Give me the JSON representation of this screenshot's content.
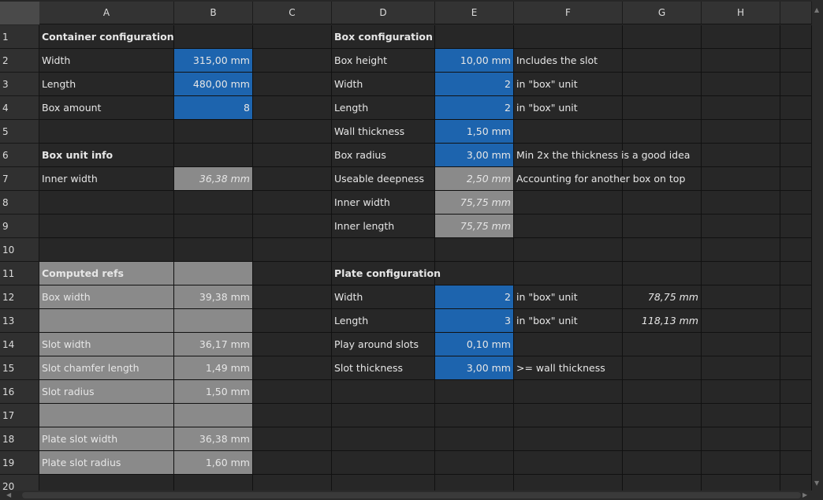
{
  "columns": [
    "A",
    "B",
    "C",
    "D",
    "E",
    "F",
    "G",
    "H"
  ],
  "rows": [
    "1",
    "2",
    "3",
    "4",
    "5",
    "6",
    "7",
    "8",
    "9",
    "10",
    "11",
    "12",
    "13",
    "14",
    "15",
    "16",
    "17",
    "18",
    "19",
    "20"
  ],
  "cells": [
    {
      "ref": "A1",
      "v": "Container configuration",
      "bold": true
    },
    {
      "ref": "D1",
      "v": "Box configuration",
      "bold": true
    },
    {
      "ref": "A2",
      "v": "Width"
    },
    {
      "ref": "B2",
      "v": "315,00 mm",
      "align": "right",
      "fill": "blue"
    },
    {
      "ref": "D2",
      "v": "Box height"
    },
    {
      "ref": "E2",
      "v": "10,00 mm",
      "align": "right",
      "fill": "blue"
    },
    {
      "ref": "F2",
      "v": "Includes the slot"
    },
    {
      "ref": "A3",
      "v": "Length"
    },
    {
      "ref": "B3",
      "v": "480,00 mm",
      "align": "right",
      "fill": "blue"
    },
    {
      "ref": "D3",
      "v": "Width"
    },
    {
      "ref": "E3",
      "v": "2",
      "align": "right",
      "fill": "blue"
    },
    {
      "ref": "F3",
      "v": "in \"box\" unit"
    },
    {
      "ref": "A4",
      "v": "Box amount"
    },
    {
      "ref": "B4",
      "v": "8",
      "align": "right",
      "fill": "blue"
    },
    {
      "ref": "D4",
      "v": "Length"
    },
    {
      "ref": "E4",
      "v": "2",
      "align": "right",
      "fill": "blue"
    },
    {
      "ref": "F4",
      "v": "in \"box\" unit"
    },
    {
      "ref": "D5",
      "v": "Wall thickness"
    },
    {
      "ref": "E5",
      "v": "1,50 mm",
      "align": "right",
      "fill": "blue"
    },
    {
      "ref": "A6",
      "v": "Box unit info",
      "bold": true
    },
    {
      "ref": "D6",
      "v": "Box radius"
    },
    {
      "ref": "E6",
      "v": "3,00 mm",
      "align": "right",
      "fill": "blue"
    },
    {
      "ref": "F6",
      "v": "Min 2x the thickness is a good idea"
    },
    {
      "ref": "A7",
      "v": "Inner width"
    },
    {
      "ref": "B7",
      "v": "36,38 mm",
      "align": "right",
      "fill": "gray",
      "italic": true
    },
    {
      "ref": "D7",
      "v": "Useable deepness"
    },
    {
      "ref": "E7",
      "v": "2,50 mm",
      "align": "right",
      "fill": "gray",
      "italic": true
    },
    {
      "ref": "F7",
      "v": "Accounting for another box on top"
    },
    {
      "ref": "D8",
      "v": "Inner width"
    },
    {
      "ref": "E8",
      "v": "75,75 mm",
      "align": "right",
      "fill": "gray",
      "italic": true
    },
    {
      "ref": "D9",
      "v": "Inner length"
    },
    {
      "ref": "E9",
      "v": "75,75 mm",
      "align": "right",
      "fill": "gray",
      "italic": true
    },
    {
      "ref": "A11",
      "v": "Computed refs",
      "bold": true,
      "fill": "gray"
    },
    {
      "ref": "B11",
      "v": "",
      "fill": "gray"
    },
    {
      "ref": "D11",
      "v": "Plate configuration",
      "bold": true
    },
    {
      "ref": "A12",
      "v": "Box width",
      "fill": "gray"
    },
    {
      "ref": "B12",
      "v": "39,38 mm",
      "align": "right",
      "fill": "gray"
    },
    {
      "ref": "D12",
      "v": "Width"
    },
    {
      "ref": "E12",
      "v": "2",
      "align": "right",
      "fill": "blue"
    },
    {
      "ref": "F12",
      "v": "in \"box\" unit"
    },
    {
      "ref": "G12",
      "v": "78,75 mm",
      "align": "right",
      "italic": true
    },
    {
      "ref": "A13",
      "v": "",
      "fill": "gray"
    },
    {
      "ref": "B13",
      "v": "",
      "fill": "gray"
    },
    {
      "ref": "D13",
      "v": "Length"
    },
    {
      "ref": "E13",
      "v": "3",
      "align": "right",
      "fill": "blue"
    },
    {
      "ref": "F13",
      "v": "in \"box\" unit"
    },
    {
      "ref": "G13",
      "v": "118,13 mm",
      "align": "right",
      "italic": true
    },
    {
      "ref": "A14",
      "v": "Slot width",
      "fill": "gray"
    },
    {
      "ref": "B14",
      "v": "36,17 mm",
      "align": "right",
      "fill": "gray"
    },
    {
      "ref": "D14",
      "v": "Play around slots"
    },
    {
      "ref": "E14",
      "v": "0,10 mm",
      "align": "right",
      "fill": "blue"
    },
    {
      "ref": "A15",
      "v": "Slot chamfer length",
      "fill": "gray"
    },
    {
      "ref": "B15",
      "v": "1,49 mm",
      "align": "right",
      "fill": "gray"
    },
    {
      "ref": "D15",
      "v": "Slot thickness"
    },
    {
      "ref": "E15",
      "v": "3,00 mm",
      "align": "right",
      "fill": "blue"
    },
    {
      "ref": "F15",
      "v": ">= wall thickness"
    },
    {
      "ref": "A16",
      "v": "Slot radius",
      "fill": "gray"
    },
    {
      "ref": "B16",
      "v": "1,50 mm",
      "align": "right",
      "fill": "gray"
    },
    {
      "ref": "A17",
      "v": "",
      "fill": "gray"
    },
    {
      "ref": "B17",
      "v": "",
      "fill": "gray"
    },
    {
      "ref": "A18",
      "v": "Plate slot width",
      "fill": "gray"
    },
    {
      "ref": "B18",
      "v": "36,38 mm",
      "align": "right",
      "fill": "gray"
    },
    {
      "ref": "A19",
      "v": "Plate slot radius",
      "fill": "gray"
    },
    {
      "ref": "B19",
      "v": "1,60 mm",
      "align": "right",
      "fill": "gray"
    }
  ],
  "colors": {
    "input_fill": "#1d64ae",
    "computed_fill": "#8a8a8a",
    "background": "#272727"
  }
}
